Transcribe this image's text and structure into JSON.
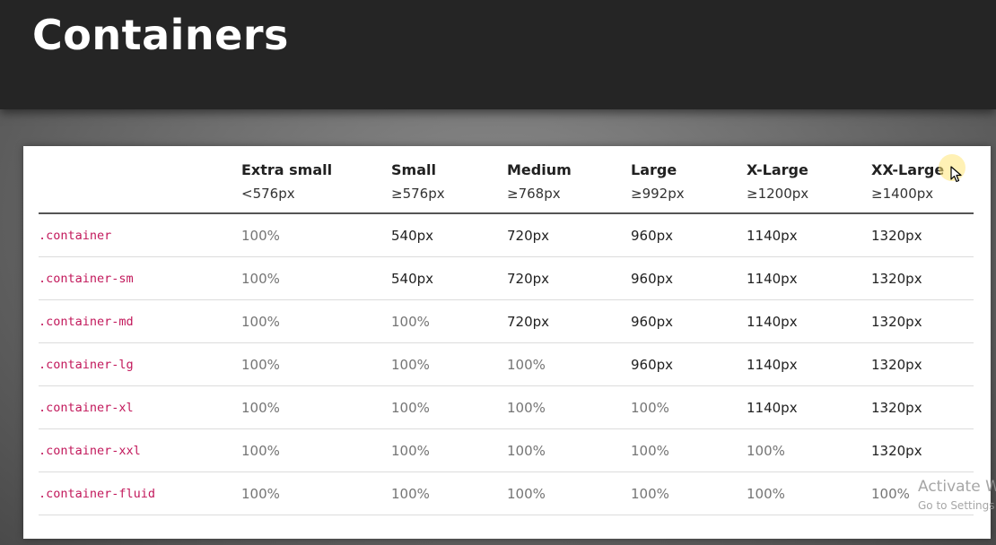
{
  "title": "Containers",
  "table": {
    "columns": [
      {
        "name": "Extra small",
        "size": "<576px"
      },
      {
        "name": "Small",
        "size": "≥576px"
      },
      {
        "name": "Medium",
        "size": "≥768px"
      },
      {
        "name": "Large",
        "size": "≥992px"
      },
      {
        "name": "X-Large",
        "size": "≥1200px"
      },
      {
        "name": "XX-Large",
        "size": "≥1400px"
      }
    ],
    "rows": [
      {
        "class": ".container",
        "values": [
          "100%",
          "540px",
          "720px",
          "960px",
          "1140px",
          "1320px"
        ]
      },
      {
        "class": ".container-sm",
        "values": [
          "100%",
          "540px",
          "720px",
          "960px",
          "1140px",
          "1320px"
        ]
      },
      {
        "class": ".container-md",
        "values": [
          "100%",
          "100%",
          "720px",
          "960px",
          "1140px",
          "1320px"
        ]
      },
      {
        "class": ".container-lg",
        "values": [
          "100%",
          "100%",
          "100%",
          "960px",
          "1140px",
          "1320px"
        ]
      },
      {
        "class": ".container-xl",
        "values": [
          "100%",
          "100%",
          "100%",
          "100%",
          "1140px",
          "1320px"
        ]
      },
      {
        "class": ".container-xxl",
        "values": [
          "100%",
          "100%",
          "100%",
          "100%",
          "100%",
          "1320px"
        ]
      },
      {
        "class": ".container-fluid",
        "values": [
          "100%",
          "100%",
          "100%",
          "100%",
          "100%",
          "100%"
        ]
      }
    ]
  },
  "watermark": {
    "line1": "Activate Windows",
    "line2": "Go to Settings to activate Windows."
  },
  "colors": {
    "class_name": "#c2185b",
    "fluid_value": "#757575",
    "fixed_value": "#212121",
    "title_bar": "#252525"
  },
  "icons": {
    "cursor": "mouse-pointer-icon"
  }
}
